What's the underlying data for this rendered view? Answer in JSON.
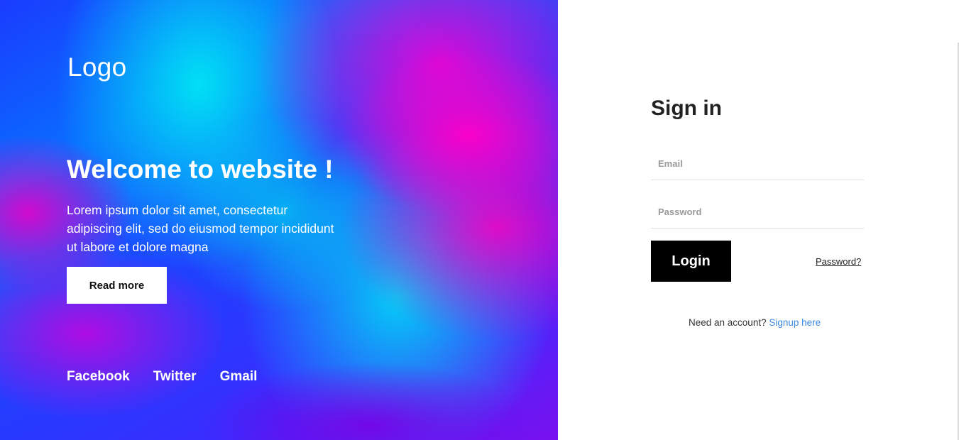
{
  "hero": {
    "logo": "Logo",
    "title": "Welcome to website !",
    "text": "Lorem ipsum dolor sit amet, consectetur adipiscing elit, sed do eiusmod tempor incididunt ut labore et dolore magna",
    "read_more_label": "Read more",
    "social": {
      "facebook": "Facebook",
      "twitter": "Twitter",
      "gmail": "Gmail"
    }
  },
  "signin": {
    "title": "Sign in",
    "email_placeholder": "Email",
    "email_value": "",
    "password_placeholder": "Password",
    "password_value": "",
    "login_label": "Login",
    "forgot_label": "Password?",
    "need_account_text": "Need an account?",
    "signup_label": "Signup here"
  },
  "colors": {
    "accent_link": "#3b8ae0",
    "button_dark": "#000000",
    "hero_primary": "#1a3cff",
    "hero_magenta": "#ff00c8",
    "hero_cyan": "#00e6f5"
  }
}
